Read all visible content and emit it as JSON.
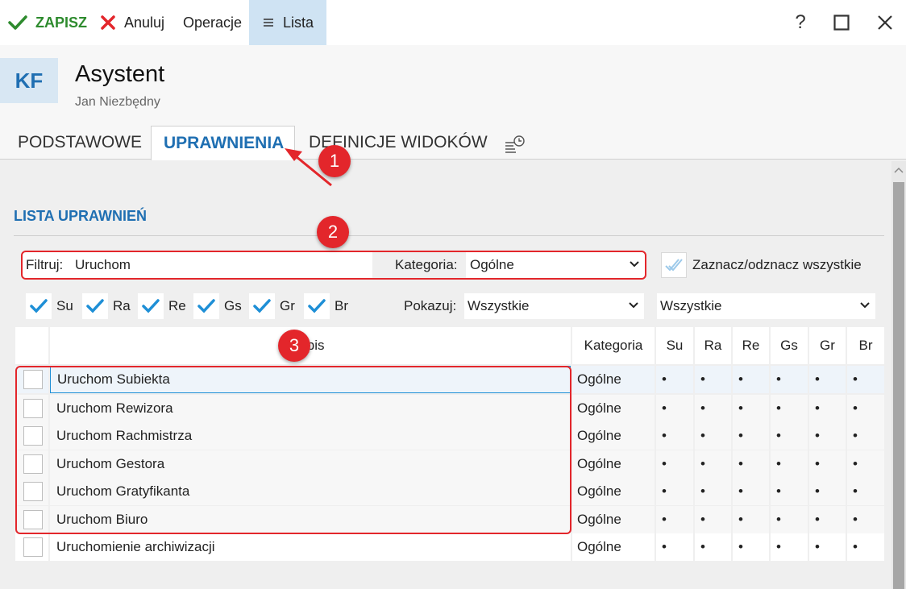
{
  "toolbar": {
    "save_label": "ZAPISZ",
    "cancel_label": "Anuluj",
    "operations_label": "Operacje",
    "list_label": "Lista",
    "help_label": "?",
    "save_color": "#2e8b2e",
    "cancel_color": "#e3262b"
  },
  "header": {
    "avatar_initials": "KF",
    "title": "Asystent",
    "subtitle": "Jan Niezbędny"
  },
  "tabs": [
    {
      "label": "PODSTAWOWE",
      "active": false
    },
    {
      "label": "UPRAWNIENIA",
      "active": true
    },
    {
      "label": "DEFINICJE WIDOKÓW",
      "active": false
    },
    {
      "icon": "history-list-icon"
    }
  ],
  "section": {
    "title": "LISTA UPRAWNIEŃ"
  },
  "filter": {
    "label": "Filtruj:",
    "value": "Uruchom",
    "category_label": "Kategoria:",
    "category_value": "Ogólne",
    "toggle_all_label": "Zaznacz/odznacz wszystkie"
  },
  "chips": [
    {
      "label": "Su",
      "checked": true
    },
    {
      "label": "Ra",
      "checked": true
    },
    {
      "label": "Re",
      "checked": true
    },
    {
      "label": "Gs",
      "checked": true
    },
    {
      "label": "Gr",
      "checked": true
    },
    {
      "label": "Br",
      "checked": true
    }
  ],
  "show": {
    "label": "Pokazuj:",
    "value1": "Wszystkie",
    "value2": "Wszystkie"
  },
  "table": {
    "columns": [
      "Opis",
      "Kategoria",
      "Su",
      "Ra",
      "Re",
      "Gs",
      "Gr",
      "Br"
    ],
    "rows": [
      {
        "opis": "Uruchom Subiekta",
        "kategoria": "Ogólne",
        "su": "•",
        "ra": "•",
        "re": "•",
        "gs": "•",
        "gr": "•",
        "br": "•"
      },
      {
        "opis": "Uruchom Rewizora",
        "kategoria": "Ogólne",
        "su": "•",
        "ra": "•",
        "re": "•",
        "gs": "•",
        "gr": "•",
        "br": "•"
      },
      {
        "opis": "Uruchom Rachmistrza",
        "kategoria": "Ogólne",
        "su": "•",
        "ra": "•",
        "re": "•",
        "gs": "•",
        "gr": "•",
        "br": "•"
      },
      {
        "opis": "Uruchom Gestora",
        "kategoria": "Ogólne",
        "su": "•",
        "ra": "•",
        "re": "•",
        "gs": "•",
        "gr": "•",
        "br": "•"
      },
      {
        "opis": "Uruchom Gratyfikanta",
        "kategoria": "Ogólne",
        "su": "•",
        "ra": "•",
        "re": "•",
        "gs": "•",
        "gr": "•",
        "br": "•"
      },
      {
        "opis": "Uruchom Biuro",
        "kategoria": "Ogólne",
        "su": "•",
        "ra": "•",
        "re": "•",
        "gs": "•",
        "gr": "•",
        "br": "•"
      },
      {
        "opis": "Uruchomienie archiwizacji",
        "kategoria": "Ogólne",
        "su": "•",
        "ra": "•",
        "re": "•",
        "gs": "•",
        "gr": "•",
        "br": "•"
      }
    ]
  },
  "annotations": {
    "badges": [
      "1",
      "2",
      "3"
    ],
    "color": "#e3262b"
  }
}
